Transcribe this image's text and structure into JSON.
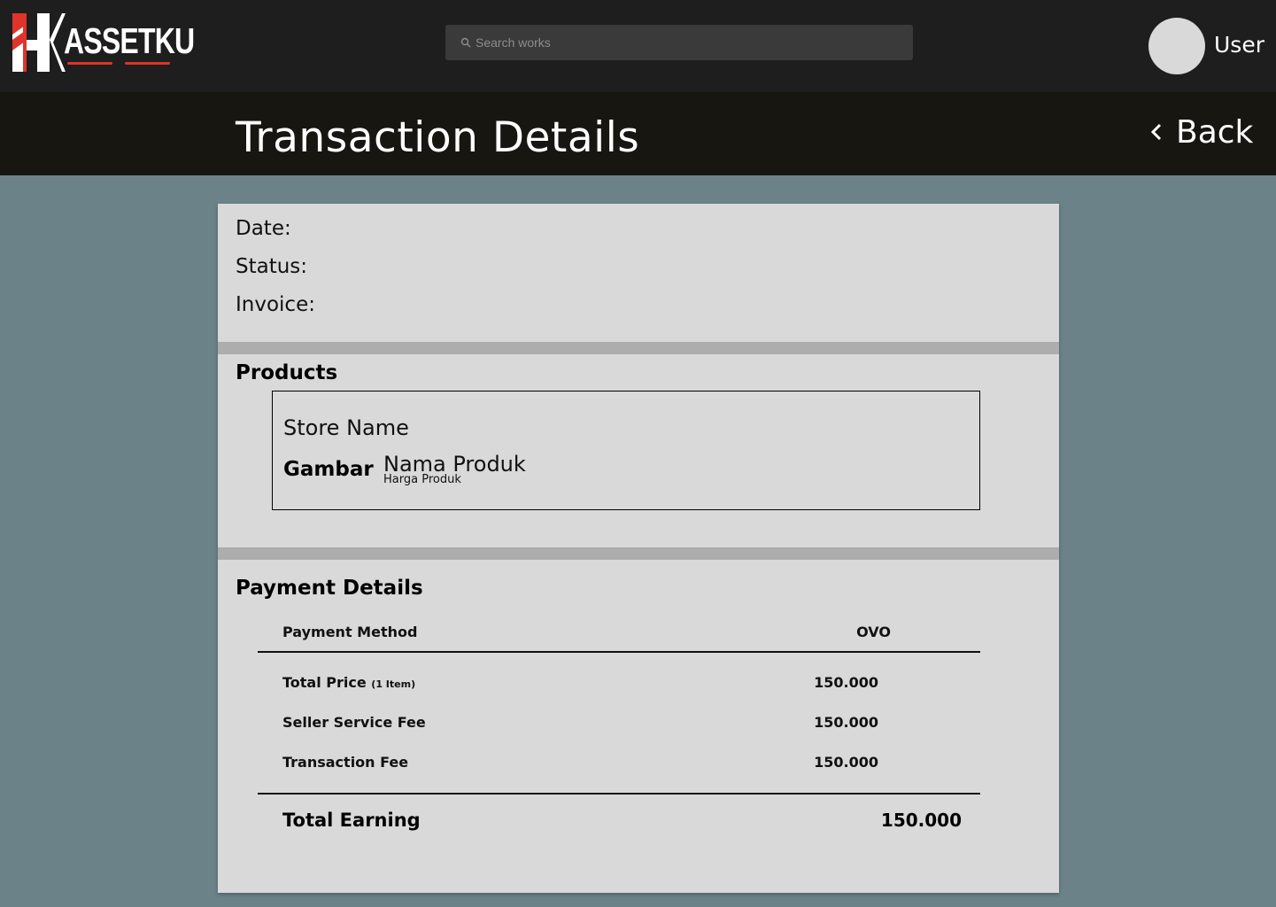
{
  "header": {
    "logo_text": "ASSETKU",
    "logo_letter": "K",
    "search_placeholder": "Search works",
    "user_label": "User",
    "colors": {
      "topbar": "#1e1e1e",
      "logo_accent": "#e0342a",
      "avatar": "#d9d9d9"
    }
  },
  "titlebar": {
    "title": "Transaction Details",
    "back_label": "Back",
    "back_icon": "chevron-left-icon"
  },
  "transaction": {
    "date_label": "Date:",
    "status_label": "Status:",
    "invoice_label": "Invoice:"
  },
  "products": {
    "section_title": "Products",
    "store_name": "Store Name",
    "image_placeholder": "Gambar",
    "product_name": "Nama Produk",
    "product_price": "Harga Produk"
  },
  "payment": {
    "section_title": "Payment Details",
    "method_label": "Payment Method",
    "method_value": "OVO",
    "rows": [
      {
        "label": "Total Price",
        "suffix": "(1 Item)",
        "value": "150.000"
      },
      {
        "label": "Seller Service Fee",
        "suffix": "",
        "value": "150.000"
      },
      {
        "label": "Transaction Fee",
        "suffix": "",
        "value": "150.000"
      }
    ],
    "total_label": "Total Earning",
    "total_value": "150.000"
  },
  "colors": {
    "page_bg": "#6b8289",
    "titlebar_bg": "#171610",
    "card_bg": "#d9d9d9",
    "divider": "#adadad"
  }
}
